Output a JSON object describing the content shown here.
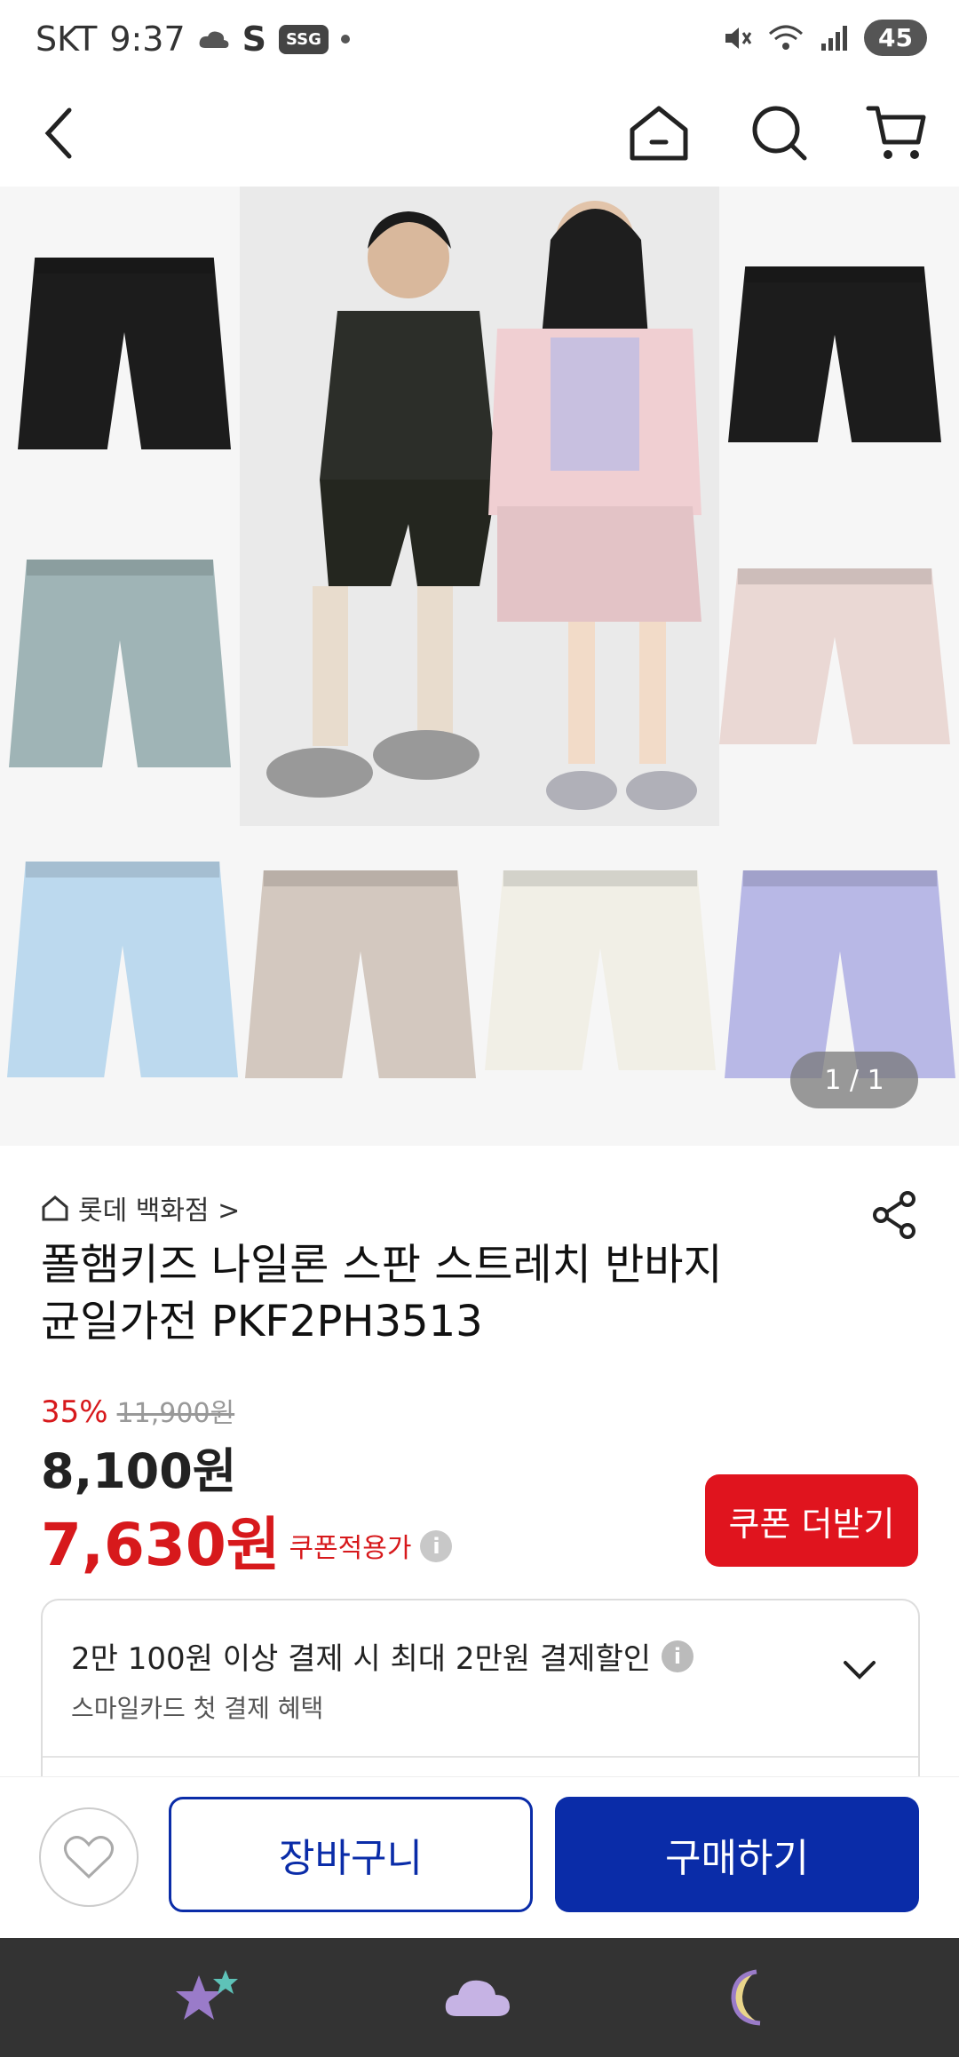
{
  "status_bar": {
    "carrier": "SKT",
    "time": "9:37",
    "s_label": "S",
    "ssg_label": "SSG",
    "battery": "45"
  },
  "nav": {
    "back_icon": "back-chevron-icon",
    "home_icon": "home-icon",
    "search_icon": "search-icon",
    "cart_icon": "cart-icon"
  },
  "gallery": {
    "pager": "1 / 1",
    "colors": [
      "#1c1c1c",
      "#9fb4b6",
      "#1c1c1c",
      "#ead8d4",
      "#bcd9ee",
      "#d3c8bf",
      "#f1efe6",
      "#b8b8e6"
    ]
  },
  "product": {
    "store": "롯데 백화점 >",
    "title_line1": "폴햄키즈 나일론 스판 스트레치 반바지",
    "title_line2": "균일가전  PKF2PH3513",
    "discount_pct": "35%",
    "original_price": "11,900원",
    "price": "8,100원",
    "coupon_price": "7,630원",
    "coupon_price_label": "쿠폰적용가",
    "coupon_button": "쿠폰 더받기"
  },
  "promo": {
    "line1": "2만 100원 이상 결제 시 최대 2만원 결제할인",
    "line2": "스마일카드 첫 결제 혜택"
  },
  "actions": {
    "cart_button": "장바구니",
    "buy_button": "구매하기"
  },
  "colors": {
    "accent_red": "#e0141e",
    "primary_blue": "#0a2ca8"
  }
}
